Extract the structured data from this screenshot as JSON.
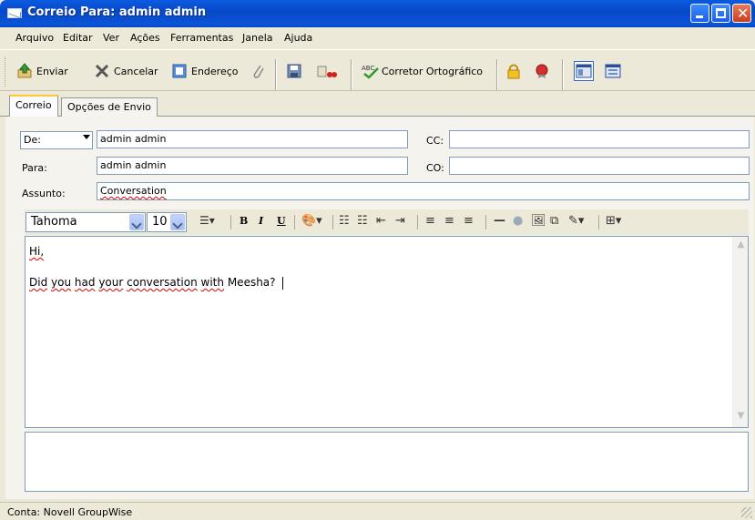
{
  "window": {
    "title": "Correio Para: admin admin"
  },
  "menu": [
    "Arquivo",
    "Editar",
    "Ver",
    "Ações",
    "Ferramentas",
    "Janela",
    "Ajuda"
  ],
  "toolbar": {
    "send": "Enviar",
    "cancel": "Cancelar",
    "address": "Endereço",
    "spell": "Corretor Ortográfico"
  },
  "tabs": [
    "Correio",
    "Opções de Envio"
  ],
  "fields": {
    "from_label": "De:",
    "from_value": "admin admin",
    "to_label": "Para:",
    "to_value": "admin admin",
    "cc_label": "CC:",
    "cc_value": "",
    "bc_label": "CO:",
    "bc_value": "",
    "subject_label": "Assunto:",
    "subject_value": "Conversation"
  },
  "format": {
    "font": "Tahoma",
    "size": "10"
  },
  "body": {
    "line1": "Hi,",
    "line2_words": [
      "Did",
      "you",
      "had",
      "your",
      "conversation",
      "with",
      "Meesha?"
    ]
  },
  "status": {
    "text": "Conta: Novell GroupWise"
  }
}
